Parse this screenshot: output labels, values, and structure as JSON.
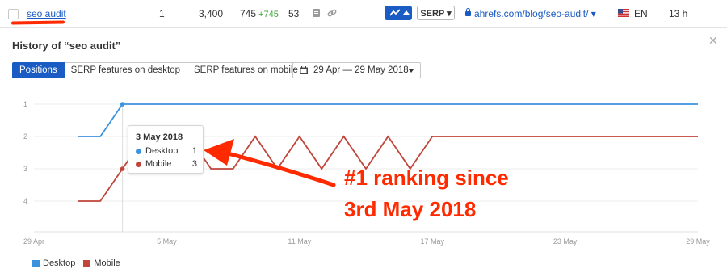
{
  "keyword_row": {
    "keyword": "seo audit",
    "position": "1",
    "volume": "3,400",
    "traffic": "745",
    "traffic_change": "+745",
    "kd": "53",
    "serp_label": "SERP",
    "url": "ahrefs.com/blog/seo-audit/",
    "language": "EN",
    "updated": "13 h"
  },
  "panel": {
    "title": "History of “seo audit”",
    "tabs": [
      {
        "label": "Positions",
        "active": true
      },
      {
        "label": "SERP features on desktop",
        "active": false
      },
      {
        "label": "SERP features on mobile",
        "active": false
      }
    ],
    "date_range": "29 Apr — 29 May 2018"
  },
  "tooltip": {
    "date": "3 May 2018",
    "rows": [
      {
        "label": "Desktop",
        "value": "1",
        "color": "#3a93dd"
      },
      {
        "label": "Mobile",
        "value": "3",
        "color": "#c0453a"
      }
    ]
  },
  "legend": [
    {
      "label": "Desktop",
      "color": "#3a93dd"
    },
    {
      "label": "Mobile",
      "color": "#c0453a"
    }
  ],
  "annotation": "#1 ranking since 3rd May 2018",
  "chart_data": {
    "type": "line",
    "x_ticks": [
      "29 Apr",
      "5 May",
      "11 May",
      "17 May",
      "23 May",
      "29 May"
    ],
    "y_ticks": [
      "1",
      "2",
      "3",
      "4"
    ],
    "ylim": [
      1,
      4
    ],
    "y_inverted": true,
    "grid": true,
    "legend_position": "bottom-left",
    "x": [
      "29 Apr",
      "30 Apr",
      "1 May",
      "2 May",
      "3 May",
      "4 May",
      "5 May",
      "6 May",
      "7 May",
      "8 May",
      "9 May",
      "10 May",
      "11 May",
      "12 May",
      "13 May",
      "14 May",
      "15 May",
      "16 May",
      "17 May",
      "18 May",
      "19 May",
      "20 May",
      "21 May",
      "22 May",
      "23 May",
      "24 May",
      "25 May",
      "26 May",
      "27 May",
      "28 May",
      "29 May"
    ],
    "series": [
      {
        "name": "Desktop",
        "color": "#3a93dd",
        "values": [
          null,
          null,
          2,
          2,
          1,
          1,
          1,
          1,
          1,
          1,
          1,
          1,
          1,
          1,
          1,
          1,
          1,
          1,
          1,
          1,
          1,
          1,
          1,
          1,
          1,
          1,
          1,
          1,
          1,
          1,
          1
        ]
      },
      {
        "name": "Mobile",
        "color": "#c0453a",
        "values": [
          null,
          null,
          4,
          4,
          3,
          2,
          2,
          2,
          3,
          3,
          2,
          3,
          2,
          3,
          2,
          3,
          2,
          3,
          2,
          2,
          2,
          2,
          2,
          2,
          2,
          2,
          2,
          2,
          2,
          2,
          2
        ]
      }
    ]
  },
  "colors": {
    "accent": "#1a5bc4",
    "annotation": "#ff2a00"
  }
}
